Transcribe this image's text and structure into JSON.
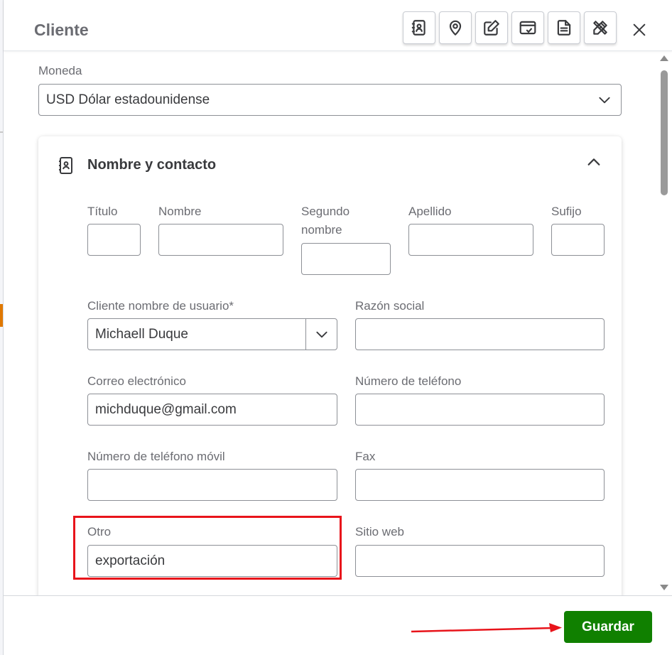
{
  "dialog": {
    "title": "Cliente",
    "toolbar": [
      "contact-card-icon",
      "location-pin-icon",
      "edit-note-icon",
      "payment-card-icon",
      "document-icon",
      "pencil-ruler-icon"
    ],
    "close_icon": "close-icon"
  },
  "currency": {
    "label": "Moneda",
    "value": "USD Dólar estadounidense"
  },
  "contact_section": {
    "title": "Nombre y contacto",
    "fields": {
      "titulo": {
        "label": "Título",
        "value": ""
      },
      "nombre": {
        "label": "Nombre",
        "value": ""
      },
      "segundo_nombre": {
        "label_line1": "Segundo",
        "label_line2": "nombre",
        "value": ""
      },
      "apellido": {
        "label": "Apellido",
        "value": ""
      },
      "sufijo": {
        "label": "Sufijo",
        "value": ""
      },
      "usuario": {
        "label": "Cliente nombre de usuario*",
        "value": "Michaell Duque"
      },
      "razon_social": {
        "label": "Razón social",
        "value": ""
      },
      "correo": {
        "label": "Correo electrónico",
        "value": "michduque@gmail.com"
      },
      "telefono": {
        "label": "Número de teléfono",
        "value": ""
      },
      "movil": {
        "label": "Número de teléfono móvil",
        "value": ""
      },
      "fax": {
        "label": "Fax",
        "value": ""
      },
      "otro": {
        "label": "Otro",
        "value": "exportación"
      },
      "sitio_web": {
        "label": "Sitio web",
        "value": ""
      }
    }
  },
  "footer": {
    "save_label": "Guardar"
  },
  "colors": {
    "primary_button": "#108000",
    "highlight": "#e8141b"
  }
}
